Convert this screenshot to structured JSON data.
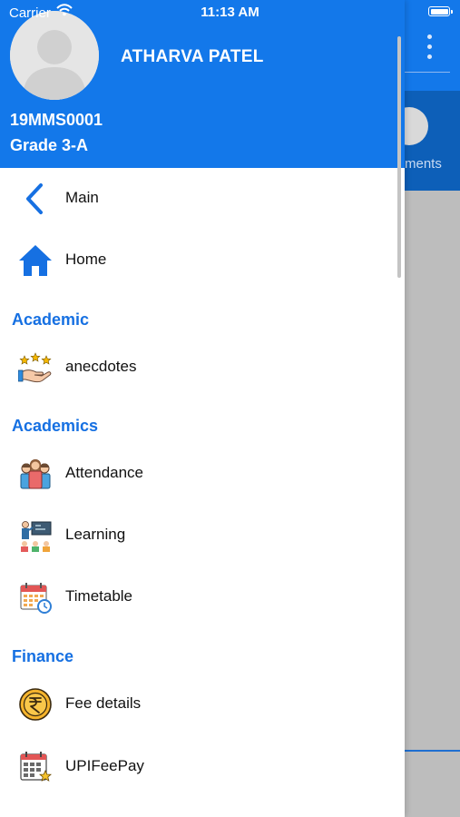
{
  "status_bar": {
    "carrier": "Carrier",
    "time": "11:13 AM"
  },
  "user": {
    "name": "ATHARVA PATEL",
    "id": "19MMS0001",
    "grade": "Grade 3-A"
  },
  "menu": {
    "main": "Main",
    "home": "Home",
    "section_academic": "Academic",
    "anecdotes": "anecdotes",
    "section_academics": "Academics",
    "attendance": "Attendance",
    "learning": "Learning",
    "timetable": "Timetable",
    "section_finance": "Finance",
    "fee_details": "Fee details",
    "upi_fee_pay": "UPIFeePay"
  },
  "background": {
    "tile_label": "ments"
  },
  "colors": {
    "primary": "#1378ea",
    "section": "#1670e2",
    "dark_blue": "#0d5fb8"
  }
}
